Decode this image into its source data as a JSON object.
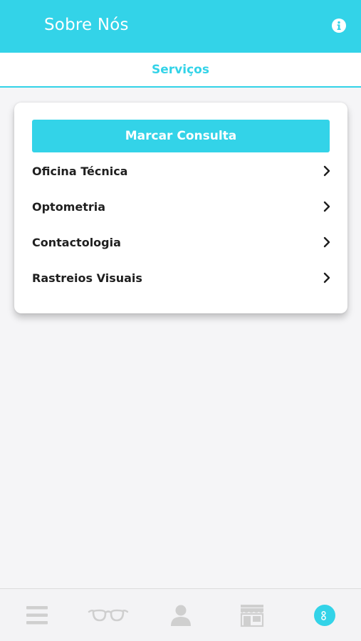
{
  "header": {
    "title": "Sobre Nós"
  },
  "tabs": [
    {
      "label": "Serviços"
    }
  ],
  "services": {
    "cta_label": "Marcar Consulta",
    "items": [
      {
        "label": "Oficina Técnica"
      },
      {
        "label": "Optometria"
      },
      {
        "label": "Contactologia"
      },
      {
        "label": "Rastreios Visuais"
      }
    ]
  },
  "bottom_nav": {
    "items": [
      {
        "icon": "menu-icon",
        "active": false
      },
      {
        "icon": "glasses-icon",
        "active": false
      },
      {
        "icon": "user-icon",
        "active": false
      },
      {
        "icon": "store-icon",
        "active": false
      },
      {
        "icon": "about-icon",
        "active": true
      }
    ]
  },
  "colors": {
    "accent": "#33d3e8",
    "icon_inactive": "#cfcfcf",
    "text": "#1f1f1f"
  }
}
